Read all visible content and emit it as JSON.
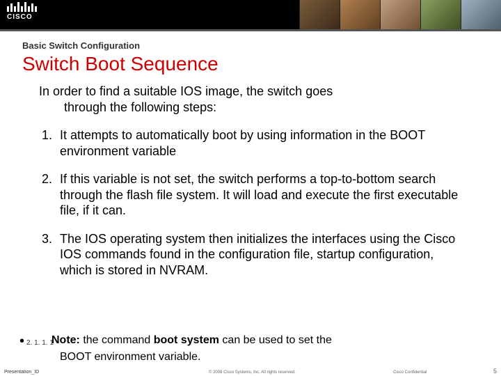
{
  "brand": {
    "name": "CISCO"
  },
  "header": {
    "section": "Basic Switch Configuration",
    "title": "Switch Boot Sequence"
  },
  "content": {
    "intro_line1": "In order to find a suitable IOS image, the switch goes",
    "intro_line2": "through the following steps:",
    "steps": [
      "It attempts to automatically boot by using information in the BOOT environment variable",
      "If this variable is not set, the switch performs a top-to-bottom search through the flash file system. It will load and execute the first executable file, if it can.",
      "The IOS operating system then initializes the interfaces using the Cisco IOS commands found in the configuration file, startup configuration, which is stored in NVRAM."
    ],
    "version_tag": "2. 1. 1. 1",
    "note_label": "Note:",
    "note_part1a": " the command ",
    "note_bold": "boot system",
    "note_part1b": " can be used to set the",
    "note_line2": "BOOT environment variable."
  },
  "footer": {
    "left": "Presentation_ID",
    "mid": "© 2008 Cisco Systems, Inc. All rights reserved.",
    "right": "Cisco Confidential",
    "page": "5"
  }
}
